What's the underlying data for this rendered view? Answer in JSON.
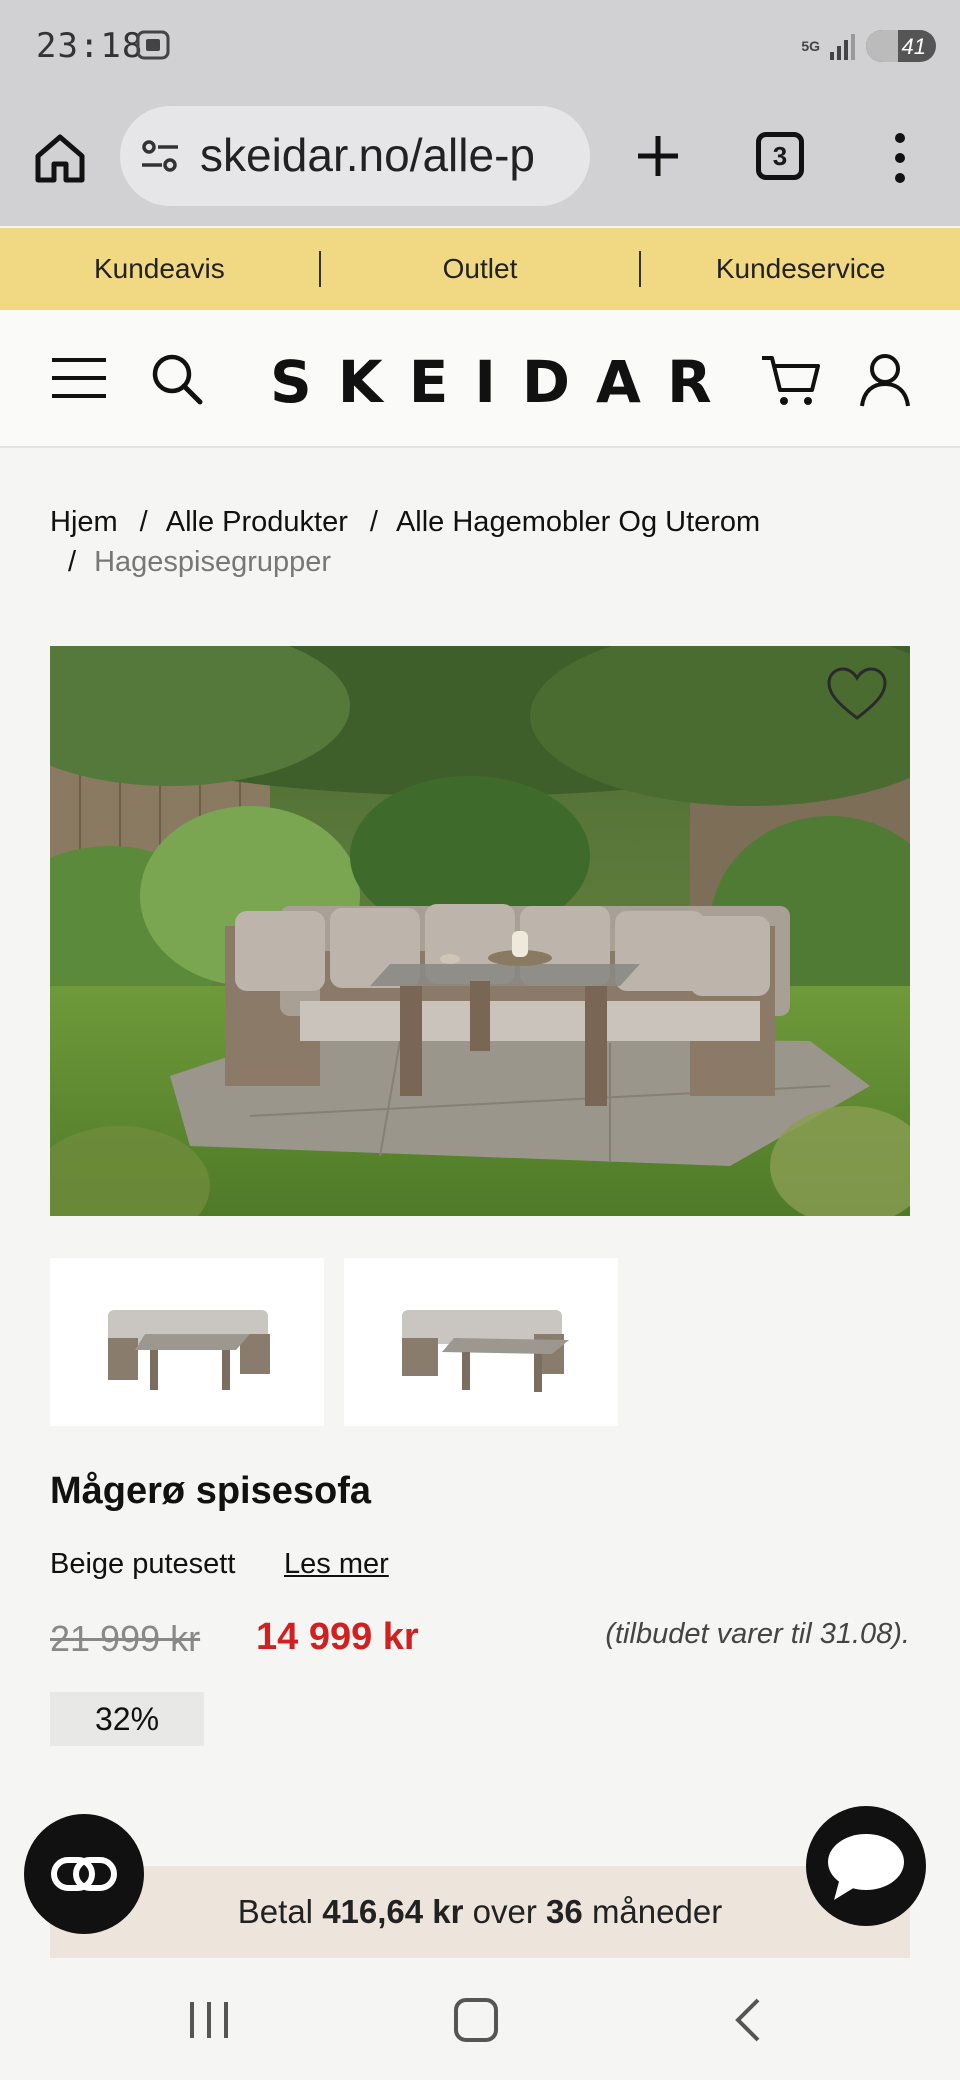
{
  "status": {
    "time": "23:18",
    "network": "5G",
    "battery": "41"
  },
  "browser": {
    "url": "skeidar.no/alle-p",
    "tab_count": "3"
  },
  "promo_nav": {
    "items": [
      "Kundeavis",
      "Outlet",
      "Kundeservice"
    ]
  },
  "header": {
    "logo": "SKEIDAR"
  },
  "breadcrumb": {
    "items": [
      "Hjem",
      "Alle Produkter",
      "Alle Hagemobler Og Uterom",
      "Hagespisegrupper"
    ]
  },
  "product": {
    "title": "Mågerø spisesofa",
    "variant": "Beige putesett",
    "read_more": "Les mer",
    "old_price": "21 999 kr",
    "new_price": "14 999 kr",
    "offer_note": "(tilbudet varer til 31.08).",
    "discount": "32%"
  },
  "installment": {
    "prefix": "Betal",
    "amount": "416,64 kr",
    "middle": "over",
    "months": "36",
    "suffix": "måneder"
  },
  "colors": {
    "promo_bg": "#f1d883",
    "sale_red": "#d21f1f",
    "installment_bg": "#ede4dc"
  }
}
